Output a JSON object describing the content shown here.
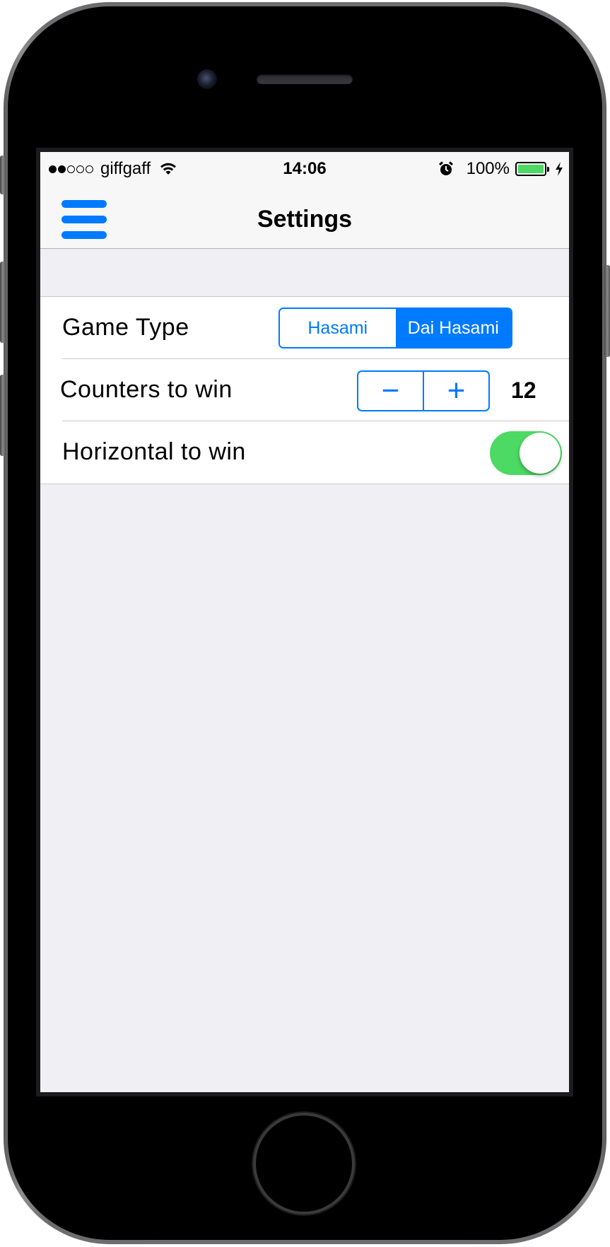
{
  "status_bar": {
    "signal_dots_filled": 2,
    "signal_dots_total": 5,
    "carrier": "giffgaff",
    "time": "14:06",
    "battery_percent": "100%",
    "battery_level": 1.0,
    "icons": [
      "wifi-icon",
      "alarm-icon",
      "battery-icon",
      "charging-bolt-icon"
    ]
  },
  "nav_bar": {
    "title": "Settings",
    "menu_icon": "hamburger-menu-icon"
  },
  "settings": {
    "game_type": {
      "label": "Game Type",
      "options": [
        "Hasami",
        "Dai Hasami"
      ],
      "selected": "Dai Hasami"
    },
    "counters_to_win": {
      "label": "Counters to win",
      "decrement": "−",
      "increment": "+",
      "value": "12"
    },
    "horizontal_to_win": {
      "label": "Horizontal to win",
      "enabled": true
    }
  },
  "colors": {
    "accent": "#007aff",
    "toggle_on": "#4cd964",
    "background": "#efeff4"
  }
}
